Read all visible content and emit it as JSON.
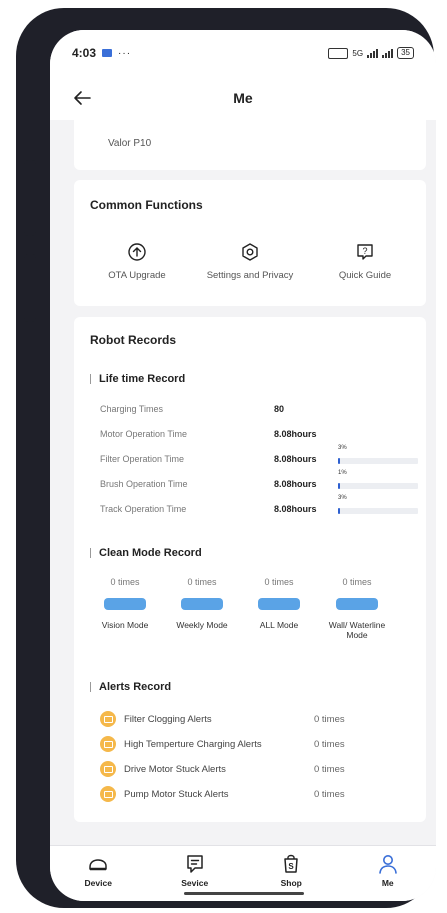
{
  "status_bar": {
    "time": "4:03",
    "dots": "···",
    "net_label": "5G",
    "battery": "35"
  },
  "header": {
    "title": "Me"
  },
  "device": {
    "name": "Valor P10"
  },
  "common_functions": {
    "title": "Common Functions",
    "items": [
      {
        "label": "OTA Upgrade",
        "icon": "upload-circle-icon"
      },
      {
        "label": "Settings and Privacy",
        "icon": "settings-hexagon-icon"
      },
      {
        "label": "Quick Guide",
        "icon": "help-chat-icon"
      }
    ]
  },
  "robot_records": {
    "title": "Robot Records",
    "life_time": {
      "title": "Life time Record",
      "rows": [
        {
          "label": "Charging Times",
          "value": "80"
        },
        {
          "label": "Motor Operation Time",
          "value": "8.08hours"
        },
        {
          "label": "Filter Operation Time",
          "value": "8.08hours",
          "pct_label": "3%",
          "pct": 0.03
        },
        {
          "label": "Brush Operation Time",
          "value": "8.08hours",
          "pct_label": "1%",
          "pct": 0.01
        },
        {
          "label": "Track Operation Time",
          "value": "8.08hours",
          "pct_label": "3%",
          "pct": 0.03
        }
      ]
    },
    "clean_mode": {
      "title": "Clean Mode Record",
      "items": [
        {
          "count": "0 times",
          "label": "Vision Mode"
        },
        {
          "count": "0 times",
          "label": "Weekly Mode"
        },
        {
          "count": "0 times",
          "label": "ALL Mode"
        },
        {
          "count": "0 times",
          "label": "Wall/ Waterline Mode"
        }
      ]
    },
    "alerts": {
      "title": "Alerts Record",
      "items": [
        {
          "label": "Filter Clogging Alerts",
          "count": "0 times"
        },
        {
          "label": "High Temperture Charging Alerts",
          "count": "0 times"
        },
        {
          "label": "Drive Motor Stuck Alerts",
          "count": "0 times"
        },
        {
          "label": "Pump Motor Stuck Alerts",
          "count": "0 times"
        }
      ]
    }
  },
  "bottom_nav": [
    {
      "label": "Device",
      "icon": "robot-device-icon"
    },
    {
      "label": "Sevice",
      "icon": "service-chat-icon"
    },
    {
      "label": "Shop",
      "icon": "shop-bag-icon"
    },
    {
      "label": "Me",
      "icon": "person-icon",
      "active": true
    }
  ],
  "colors": {
    "accent": "#2d5fd0",
    "mode_bar": "#5aa3e6",
    "alert": "#f5b84a",
    "active_nav": "#3a6fd8"
  }
}
